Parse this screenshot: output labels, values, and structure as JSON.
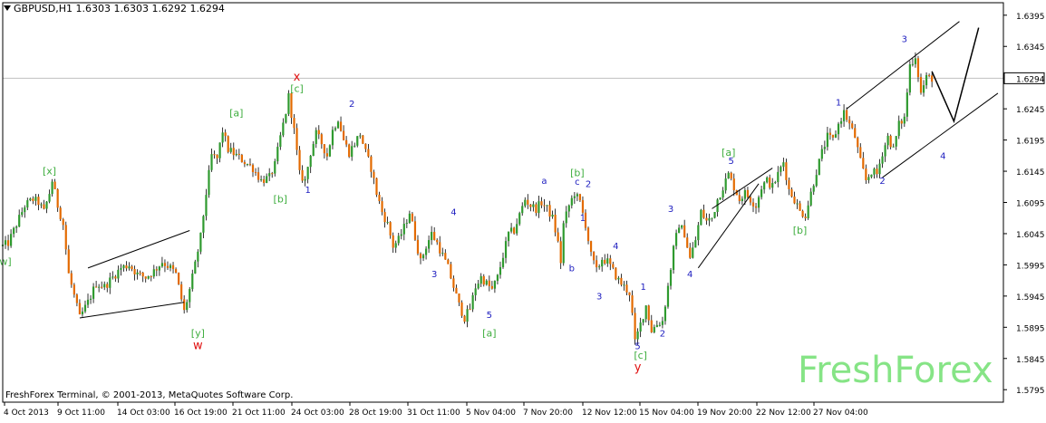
{
  "header": {
    "symbol": "GBPUSD,H1",
    "ohlc": "1.6303 1.6303 1.6292 1.6294"
  },
  "footer": {
    "copyright": "FreshForex Terminal, © 2001-2013, MetaQuotes Software Corp.",
    "brand": "FreshForex"
  },
  "colors": {
    "background": "#ffffff",
    "grid": "#c0c0c0",
    "candle_up": "#2f9a2f",
    "candle_down": "#e36a00",
    "wick": "#000000",
    "bid_line": "#c0c0c0",
    "wave_blue": "#2020c0",
    "wave_green": "#3fae3f",
    "wave_red": "#e01010",
    "brand": "#86e486"
  },
  "chart_data": {
    "type": "candlestick",
    "symbol": "GBPUSD",
    "timeframe": "H1",
    "xlabel": "",
    "ylabel": "",
    "ylim": [
      1.5775,
      1.6415
    ],
    "y_ticks": [
      "1.6395",
      "1.6345",
      "1.6245",
      "1.6195",
      "1.6145",
      "1.6095",
      "1.6045",
      "1.5995",
      "1.5945",
      "1.5895",
      "1.5845",
      "1.5795"
    ],
    "current_price": "1.6294",
    "x_ticks": [
      "4 Oct 2013",
      "9 Oct 11:00",
      "14 Oct 03:00",
      "16 Oct 19:00",
      "21 Oct 11:00",
      "24 Oct 03:00",
      "28 Oct 19:00",
      "31 Oct 11:00",
      "5 Nov 04:00",
      "7 Nov 20:00",
      "12 Nov 12:00",
      "15 Nov 04:00",
      "19 Nov 20:00",
      "22 Nov 12:00",
      "27 Nov 04:00"
    ],
    "price_path": [
      [
        0,
        1.6025
      ],
      [
        2,
        1.603
      ],
      [
        5,
        1.606
      ],
      [
        8,
        1.609
      ],
      [
        11,
        1.61
      ],
      [
        13,
        1.6095
      ],
      [
        15,
        1.608
      ],
      [
        17,
        1.611
      ],
      [
        18,
        1.613
      ],
      [
        20,
        1.609
      ],
      [
        22,
        1.606
      ],
      [
        24,
        1.598
      ],
      [
        26,
        1.5945
      ],
      [
        28,
        1.591
      ],
      [
        31,
        1.5935
      ],
      [
        34,
        1.5965
      ],
      [
        37,
        1.596
      ],
      [
        40,
        1.5975
      ],
      [
        43,
        1.599
      ],
      [
        46,
        1.5995
      ],
      [
        49,
        1.598
      ],
      [
        52,
        1.5975
      ],
      [
        55,
        1.5985
      ],
      [
        58,
        1.6
      ],
      [
        61,
        1.599
      ],
      [
        63,
        1.598
      ],
      [
        66,
        1.592
      ],
      [
        68,
        1.5955
      ],
      [
        70,
        1.5995
      ],
      [
        72,
        1.604
      ],
      [
        74,
        1.611
      ],
      [
        76,
        1.617
      ],
      [
        78,
        1.6165
      ],
      [
        80,
        1.621
      ],
      [
        82,
        1.618
      ],
      [
        85,
        1.617
      ],
      [
        88,
        1.616
      ],
      [
        91,
        1.615
      ],
      [
        94,
        1.613
      ],
      [
        97,
        1.6135
      ],
      [
        99,
        1.6155
      ],
      [
        101,
        1.62
      ],
      [
        103,
        1.624
      ],
      [
        104,
        1.6265
      ],
      [
        106,
        1.621
      ],
      [
        108,
        1.614
      ],
      [
        110,
        1.613
      ],
      [
        112,
        1.6175
      ],
      [
        114,
        1.6205
      ],
      [
        116,
        1.619
      ],
      [
        118,
        1.617
      ],
      [
        120,
        1.621
      ],
      [
        122,
        1.623
      ],
      [
        124,
        1.6195
      ],
      [
        126,
        1.6175
      ],
      [
        128,
        1.619
      ],
      [
        130,
        1.6205
      ],
      [
        132,
        1.6175
      ],
      [
        134,
        1.615
      ],
      [
        136,
        1.611
      ],
      [
        138,
        1.608
      ],
      [
        140,
        1.606
      ],
      [
        142,
        1.6025
      ],
      [
        144,
        1.6035
      ],
      [
        146,
        1.6055
      ],
      [
        148,
        1.608
      ],
      [
        150,
        1.604
      ],
      [
        152,
        1.6
      ],
      [
        154,
        1.6025
      ],
      [
        156,
        1.6045
      ],
      [
        158,
        1.603
      ],
      [
        160,
        1.601
      ],
      [
        162,
        1.599
      ],
      [
        164,
        1.596
      ],
      [
        166,
        1.593
      ],
      [
        168,
        1.591
      ],
      [
        170,
        1.5925
      ],
      [
        172,
        1.596
      ],
      [
        174,
        1.5975
      ],
      [
        176,
        1.5965
      ],
      [
        178,
        1.5955
      ],
      [
        180,
        1.5975
      ],
      [
        182,
        1.601
      ],
      [
        184,
        1.6045
      ],
      [
        186,
        1.605
      ],
      [
        188,
        1.6075
      ],
      [
        190,
        1.61
      ],
      [
        192,
        1.609
      ],
      [
        194,
        1.6085
      ],
      [
        196,
        1.6095
      ],
      [
        198,
        1.6085
      ],
      [
        200,
        1.607
      ],
      [
        202,
        1.603
      ],
      [
        203,
        1.6
      ],
      [
        204,
        1.606
      ],
      [
        206,
        1.609
      ],
      [
        208,
        1.611
      ],
      [
        210,
        1.6095
      ],
      [
        212,
        1.606
      ],
      [
        214,
        1.601
      ],
      [
        216,
        1.5985
      ],
      [
        218,
        1.6005
      ],
      [
        220,
        1.6
      ],
      [
        222,
        1.5985
      ],
      [
        224,
        1.597
      ],
      [
        226,
        1.596
      ],
      [
        228,
        1.595
      ],
      [
        229,
        1.5915
      ],
      [
        230,
        1.587
      ],
      [
        232,
        1.59
      ],
      [
        234,
        1.593
      ],
      [
        236,
        1.589
      ],
      [
        238,
        1.59
      ],
      [
        240,
        1.5905
      ],
      [
        242,
        1.596
      ],
      [
        244,
        1.602
      ],
      [
        246,
        1.606
      ],
      [
        248,
        1.6045
      ],
      [
        250,
        1.6005
      ],
      [
        252,
        1.6035
      ],
      [
        254,
        1.608
      ],
      [
        256,
        1.6065
      ],
      [
        258,
        1.607
      ],
      [
        260,
        1.61
      ],
      [
        262,
        1.612
      ],
      [
        264,
        1.614
      ],
      [
        266,
        1.612
      ],
      [
        268,
        1.61
      ],
      [
        270,
        1.611
      ],
      [
        272,
        1.61
      ],
      [
        274,
        1.609
      ],
      [
        276,
        1.612
      ],
      [
        278,
        1.613
      ],
      [
        280,
        1.612
      ],
      [
        282,
        1.614
      ],
      [
        284,
        1.616
      ],
      [
        286,
        1.6115
      ],
      [
        288,
        1.61
      ],
      [
        290,
        1.608
      ],
      [
        292,
        1.6075
      ],
      [
        294,
        1.611
      ],
      [
        296,
        1.6145
      ],
      [
        298,
        1.6175
      ],
      [
        300,
        1.62
      ],
      [
        302,
        1.6195
      ],
      [
        304,
        1.622
      ],
      [
        306,
        1.624
      ],
      [
        308,
        1.622
      ],
      [
        310,
        1.62
      ],
      [
        312,
        1.616
      ],
      [
        314,
        1.613
      ],
      [
        316,
        1.6145
      ],
      [
        318,
        1.614
      ],
      [
        320,
        1.6175
      ],
      [
        322,
        1.62
      ],
      [
        324,
        1.618
      ],
      [
        326,
        1.622
      ],
      [
        328,
        1.623
      ],
      [
        330,
        1.6315
      ],
      [
        332,
        1.633
      ],
      [
        334,
        1.627
      ],
      [
        336,
        1.6295
      ],
      [
        338,
        1.6294
      ]
    ],
    "channels": [
      {
        "from": [
          28,
          1.591
        ],
        "to": [
          66,
          1.5935
        ]
      },
      {
        "from": [
          31,
          1.599
        ],
        "to": [
          68,
          1.605
        ]
      },
      {
        "from": [
          253,
          1.599
        ],
        "to": [
          275,
          1.6125
        ]
      },
      {
        "from": [
          258,
          1.6085
        ],
        "to": [
          280,
          1.615
        ]
      },
      {
        "from": [
          307,
          1.6245
        ],
        "to": [
          348,
          1.6385
        ]
      },
      {
        "from": [
          320,
          1.6135
        ],
        "to": [
          362,
          1.627
        ]
      }
    ],
    "projection": [
      [
        338,
        1.6305
      ],
      [
        346,
        1.6225
      ],
      [
        355,
        1.6375
      ]
    ],
    "bid_line_price": 1.6294,
    "annotations": [
      {
        "text": "w]",
        "x": 1,
        "y": 1.5995,
        "color": "green"
      },
      {
        "text": "[x]",
        "x": 17,
        "y": 1.614,
        "color": "green"
      },
      {
        "text": "[y]",
        "x": 71,
        "y": 1.588,
        "color": "green"
      },
      {
        "text": "w",
        "x": 71,
        "y": 1.586,
        "color": "red"
      },
      {
        "text": "[a]",
        "x": 85,
        "y": 1.6233,
        "color": "green"
      },
      {
        "text": "[b]",
        "x": 101,
        "y": 1.6095,
        "color": "green"
      },
      {
        "text": "x",
        "x": 107,
        "y": 1.629,
        "color": "red"
      },
      {
        "text": "[c]",
        "x": 107,
        "y": 1.6272,
        "color": "green"
      },
      {
        "text": "1",
        "x": 111,
        "y": 1.611,
        "color": "blue"
      },
      {
        "text": "2",
        "x": 127,
        "y": 1.6248,
        "color": "blue"
      },
      {
        "text": "3",
        "x": 157,
        "y": 1.5975,
        "color": "blue"
      },
      {
        "text": "4",
        "x": 164,
        "y": 1.6075,
        "color": "blue"
      },
      {
        "text": "5",
        "x": 177,
        "y": 1.591,
        "color": "blue"
      },
      {
        "text": "[a]",
        "x": 177,
        "y": 1.588,
        "color": "green"
      },
      {
        "text": "a",
        "x": 197,
        "y": 1.6125,
        "color": "blue"
      },
      {
        "text": "b",
        "x": 207,
        "y": 1.5985,
        "color": "blue"
      },
      {
        "text": "[b]",
        "x": 209,
        "y": 1.6137,
        "color": "green"
      },
      {
        "text": "c",
        "x": 209,
        "y": 1.6123,
        "color": "blue"
      },
      {
        "text": "2",
        "x": 213,
        "y": 1.612,
        "color": "blue"
      },
      {
        "text": "1",
        "x": 211,
        "y": 1.6065,
        "color": "blue"
      },
      {
        "text": "4",
        "x": 223,
        "y": 1.602,
        "color": "blue"
      },
      {
        "text": "3",
        "x": 217,
        "y": 1.594,
        "color": "blue"
      },
      {
        "text": "1",
        "x": 233,
        "y": 1.5955,
        "color": "blue"
      },
      {
        "text": "2",
        "x": 240,
        "y": 1.588,
        "color": "blue"
      },
      {
        "text": "5",
        "x": 231,
        "y": 1.586,
        "color": "blue"
      },
      {
        "text": "[c]",
        "x": 232,
        "y": 1.5845,
        "color": "green"
      },
      {
        "text": "y",
        "x": 231,
        "y": 1.5825,
        "color": "red"
      },
      {
        "text": "3",
        "x": 243,
        "y": 1.608,
        "color": "blue"
      },
      {
        "text": "4",
        "x": 250,
        "y": 1.5975,
        "color": "blue"
      },
      {
        "text": "[a]",
        "x": 264,
        "y": 1.617,
        "color": "green"
      },
      {
        "text": "5",
        "x": 265,
        "y": 1.6157,
        "color": "blue"
      },
      {
        "text": "[b]",
        "x": 290,
        "y": 1.6045,
        "color": "green"
      },
      {
        "text": "1",
        "x": 304,
        "y": 1.625,
        "color": "blue"
      },
      {
        "text": "2",
        "x": 320,
        "y": 1.6125,
        "color": "blue"
      },
      {
        "text": "3",
        "x": 328,
        "y": 1.6352,
        "color": "blue"
      },
      {
        "text": "4",
        "x": 342,
        "y": 1.6165,
        "color": "blue"
      }
    ]
  }
}
